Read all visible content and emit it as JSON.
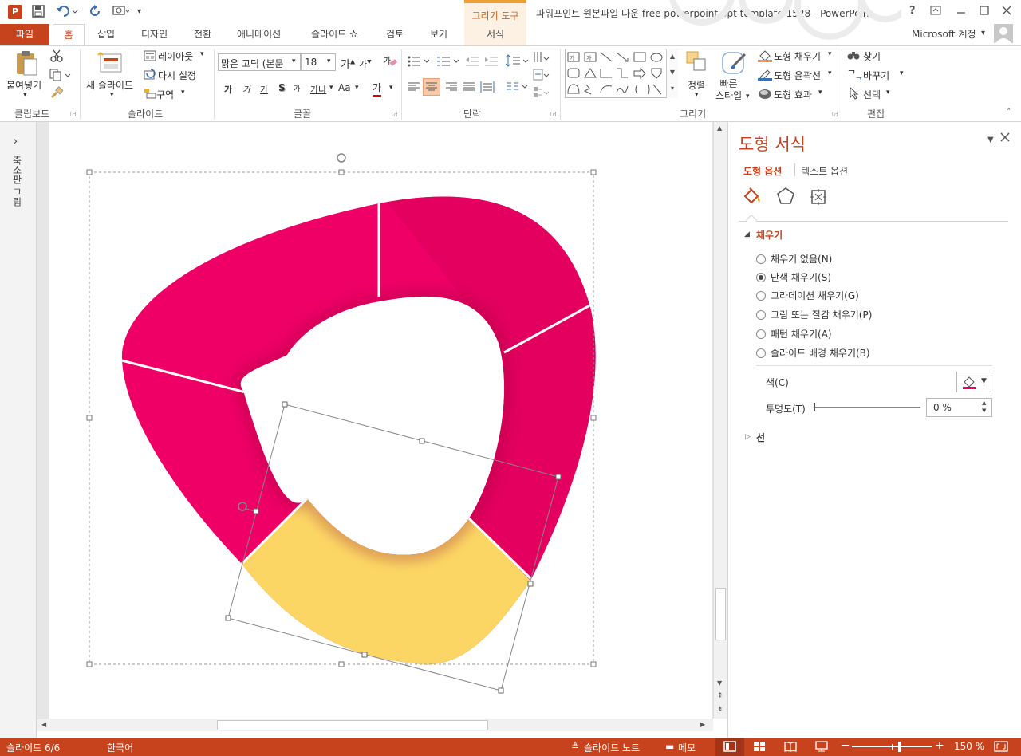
{
  "window": {
    "title": "파워포인트 원본파일 다운 free powerpoint ppt template 1528 - PowerPoint",
    "contextual_tab_group": "그리기 도구",
    "help": "?",
    "account": "Microsoft 계정"
  },
  "tabs": {
    "file": "파일",
    "home": "홈",
    "insert": "삽입",
    "design": "디자인",
    "transitions": "전환",
    "animations": "애니메이션",
    "slideshow": "슬라이드 쇼",
    "review": "검토",
    "view": "보기",
    "format": "서식"
  },
  "ribbon": {
    "clipboard": {
      "paste": "붙여넣기",
      "group": "클립보드"
    },
    "slides": {
      "new_slide": "새 슬라이드",
      "layout": "레이아웃",
      "reset": "다시 설정",
      "section": "구역",
      "group": "슬라이드"
    },
    "font": {
      "name": "맑은 고딕 (본문",
      "size": "18",
      "bold": "가",
      "italic": "가",
      "underline": "가",
      "shadow": "S",
      "strike": "가",
      "spacing": "가나",
      "case": "Aa",
      "color": "가",
      "group": "글꼴"
    },
    "paragraph": {
      "group": "단락"
    },
    "drawing": {
      "arrange": "정렬",
      "quick_styles": "빠른\n스타일",
      "fill": "도형 채우기",
      "outline": "도형 윤곽선",
      "effects": "도형 효과",
      "group": "그리기"
    },
    "editing": {
      "find": "찾기",
      "replace": "바꾸기",
      "select": "선택",
      "group": "편집"
    }
  },
  "left_pane": {
    "label": "축소판 그림",
    "toggle": "›"
  },
  "format_pane": {
    "title": "도형 서식",
    "tabs": [
      "도형 옵션",
      "텍스트 옵션"
    ],
    "section_fill": "채우기",
    "fill_options": [
      {
        "label": "채우기 없음(N)",
        "selected": false
      },
      {
        "label": "단색 채우기(S)",
        "selected": true
      },
      {
        "label": "그라데이션 채우기(G)",
        "selected": false
      },
      {
        "label": "그림 또는 질감 채우기(P)",
        "selected": false
      },
      {
        "label": "패턴 채우기(A)",
        "selected": false
      },
      {
        "label": "슬라이드 배경 채우기(B)",
        "selected": false
      }
    ],
    "color_label": "색(C)",
    "transparency_label": "투명도(T)",
    "transparency_value": "0 %",
    "section_line": "선"
  },
  "status": {
    "slide": "슬라이드 6/6",
    "language": "한국어",
    "notes": "슬라이드 노트",
    "comments": "메모",
    "zoom": "150 %"
  },
  "colors": {
    "accent": "#c6431e",
    "pink": "#ee0066",
    "yellow": "#fcd665"
  }
}
